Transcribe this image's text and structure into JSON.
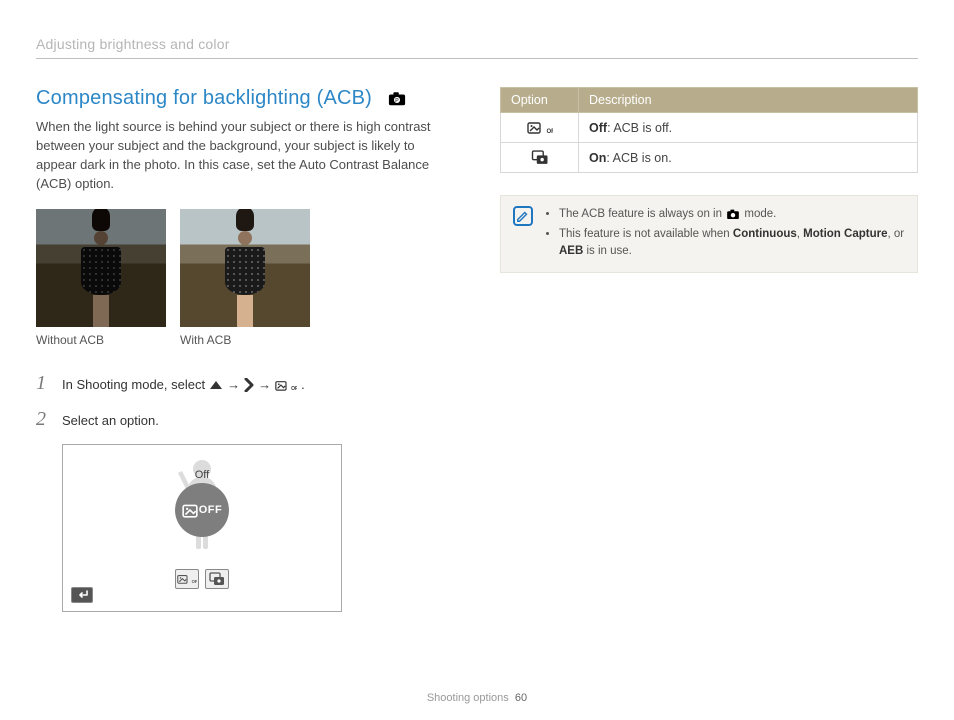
{
  "header": {
    "breadcrumb": "Adjusting brightness and color"
  },
  "section": {
    "title": "Compensating for backlighting (ACB)",
    "mode_icon": "camera-p-icon",
    "intro": "When the light source is behind your subject or there is high contrast between your subject and the background, your subject is likely to appear dark in the photo. In this case, set the Auto Contrast Balance (ACB) option."
  },
  "photos": {
    "left_caption": "Without ACB",
    "right_caption": "With ACB"
  },
  "steps": [
    {
      "num": "1",
      "prefix": "In Shooting mode, select ",
      "suffix": "."
    },
    {
      "num": "2",
      "text": "Select an option."
    }
  ],
  "lcd": {
    "bubble_label": "Off",
    "off_text": "OFF",
    "back_icon": "return-icon"
  },
  "table": {
    "headers": [
      "Option",
      "Description"
    ],
    "rows": [
      {
        "icon": "acb-off-icon",
        "label": "Off",
        "desc": ": ACB is off."
      },
      {
        "icon": "acb-on-icon",
        "label": "On",
        "desc": ": ACB is on."
      }
    ]
  },
  "note": {
    "items": [
      {
        "prefix": "The ACB feature is always on in ",
        "icon": "camera-auto-icon",
        "suffix": " mode."
      },
      {
        "prefix": "This feature is not available when ",
        "bold": [
          "Continuous",
          "Motion Capture",
          "AEB"
        ],
        "join": ", ",
        "last_join": ", or ",
        "suffix": " is in use."
      }
    ]
  },
  "footer": {
    "section": "Shooting options",
    "page": "60"
  },
  "arrows": {
    "glyph": "→"
  }
}
